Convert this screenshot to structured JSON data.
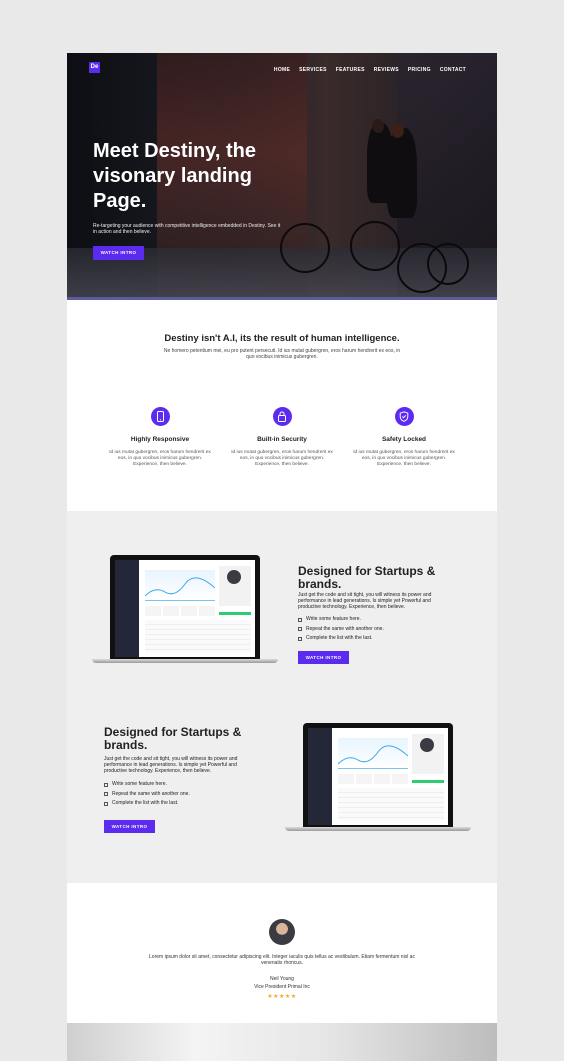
{
  "header": {
    "logo_text": "De",
    "nav": [
      "HOME",
      "SERVICES",
      "FEATURES",
      "REVIEWS",
      "PRICING",
      "CONTACT"
    ]
  },
  "hero": {
    "title": "Meet Destiny, the visonary landing Page.",
    "subtitle": "Re-targeting your audience with competitive intelligence embedded in Destiny. See it in action and then believe.",
    "button": "WATCH INTRO"
  },
  "intro": {
    "title": "Destiny isn't A.I, its the result of human intelligence.",
    "text": "Ne homero petentium mei, eu pro putent persecuti. Id ius mutat gubergren, eros harum hendrerit ex eos, in quo vocibus inimicus gubergren."
  },
  "features": [
    {
      "icon": "phone-icon",
      "title": "Highly Responsive",
      "text": "Id ius mutat gubergren, eros harum hendrerit ex eos, in quo vocibus inimicus gubergren. Experience, then believe."
    },
    {
      "icon": "lock-icon",
      "title": "Built-in Security",
      "text": "Id ius mutat gubergren, eros harum hendrerit ex eos, in quo vocibus inimicus gubergren. Experience, then believe."
    },
    {
      "icon": "shield-icon",
      "title": "Safety Locked",
      "text": "Id ius mutat gubergren, eros harum hendrerit ex eos, in quo vocibus inimicus gubergren. Experience, then believe."
    }
  ],
  "blocks": [
    {
      "title": "Designed for Startups & brands.",
      "text": "Just get the code and sit tight, you will witness its power and performance in lead generations. Is simple yet Powerful and productive technology. Experience, then believe.",
      "list": [
        "Write some feature here.",
        "Repeat the same with another one.",
        "Complete the list with the last."
      ],
      "button": "WATCH INTRO"
    },
    {
      "title": "Designed for Startups & brands.",
      "text": "Just get the code and sit tight, you will witness its power and performance in lead generations. Is simple yet Powerful and productive technology. Experience, then believe.",
      "list": [
        "Write some feature here.",
        "Repeat the same with another one.",
        "Complete the list with the last."
      ],
      "button": "WATCH INTRO"
    }
  ],
  "testimonial": {
    "quote": "Lorem ipsum dolor sit amet, consectetur adipiscing elit. Integer iaculis quis tellus ac vestibulum. Etiam fermentum nisl ac venenatis rhoncus.",
    "name": "Neil Young",
    "role": "Vice President Primal Inc",
    "stars": "★★★★★",
    "rating": 5
  },
  "colors": {
    "accent": "#5b2bf0",
    "star": "#f5a623"
  }
}
